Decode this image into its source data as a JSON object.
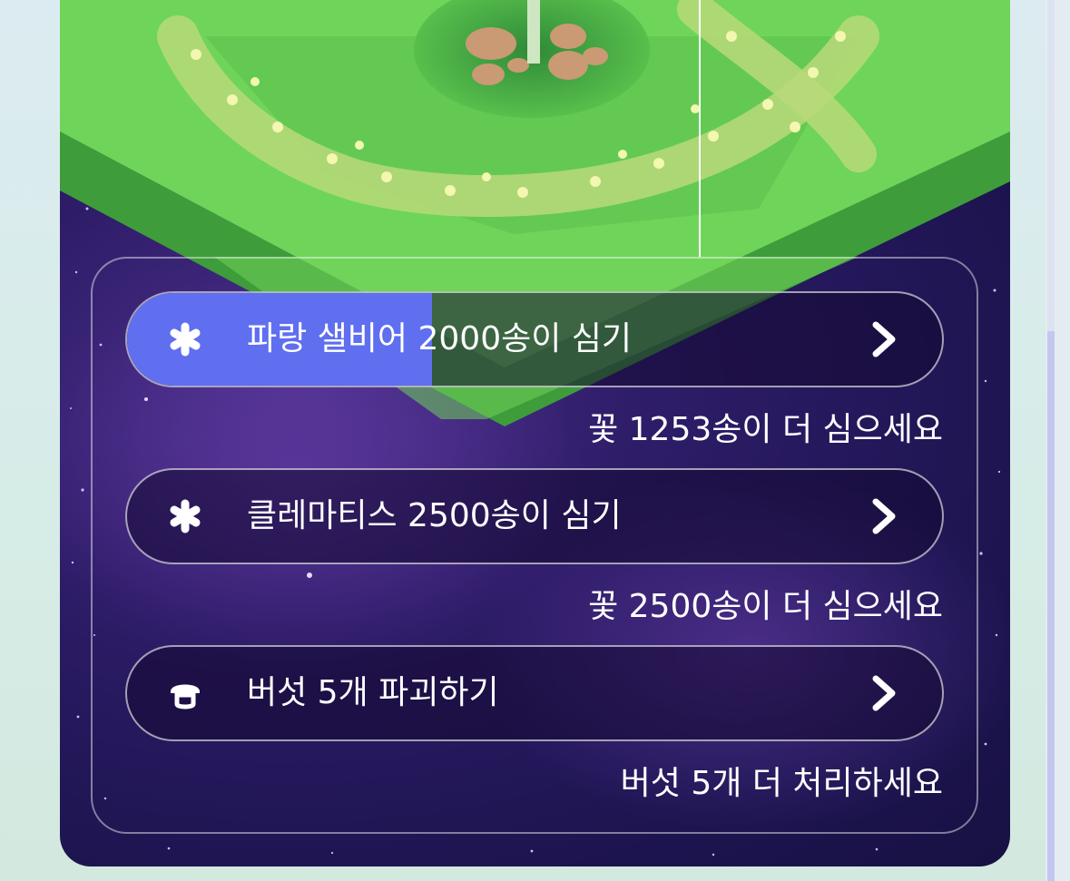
{
  "quests": [
    {
      "icon": "asterisk-flower-icon",
      "label": "파랑 샐비어 2000송이 심기",
      "progress": 0.374,
      "hint": "꽃 1253송이 더 심으세요"
    },
    {
      "icon": "asterisk-flower-icon",
      "label": "클레마티스 2500송이 심기",
      "progress": 0,
      "hint": "꽃 2500송이 더 심으세요"
    },
    {
      "icon": "mushroom-icon",
      "label": "버섯 5개 파괴하기",
      "progress": 0,
      "hint": "버섯 5개 더 처리하세요"
    }
  ],
  "colors": {
    "progress_fill": "#5f6ff0",
    "grass": "#6fd45a",
    "space": "#241a5c"
  }
}
